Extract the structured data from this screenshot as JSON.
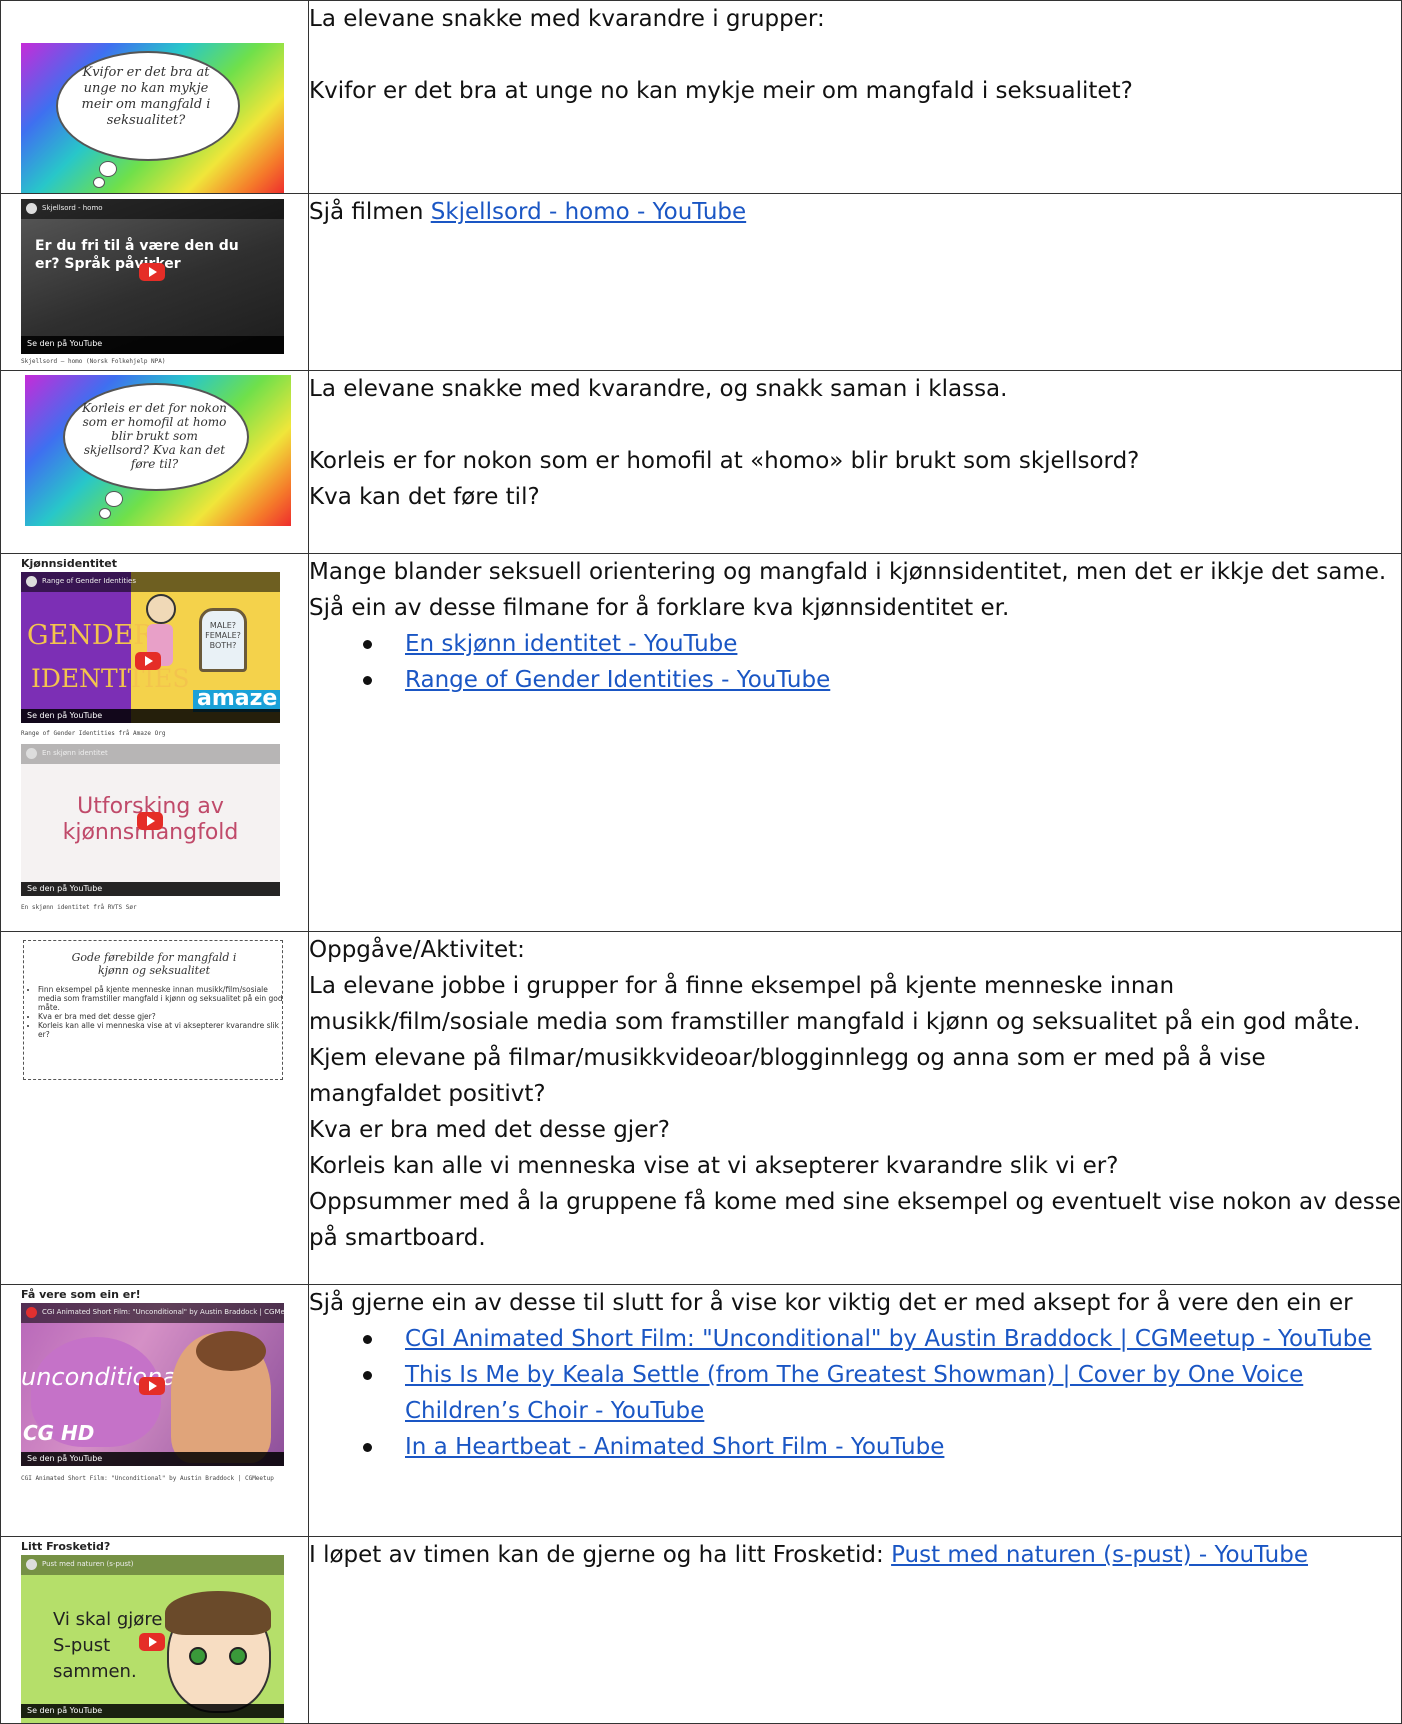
{
  "rows": [
    {
      "thumb": {
        "cloud_text": "Kvifor er det bra at unge no kan mykje meir om mangfald i seksualitet?"
      },
      "paragraphs": [
        "La elevane snakke med kvarandre i grupper:",
        "",
        "Kvifor er det bra at unge no kan mykje meir om mangfald i seksualitet?"
      ]
    },
    {
      "thumb": {
        "video_title": "Skjellsord - homo",
        "overlay_text": "Er du fri til å være den du er? Språk påvirker",
        "bar_text": "Se den på YouTube",
        "caption": "Skjellsord – homo (Norsk Folkehjelp NPA)"
      },
      "text_prefix": "Sjå filmen ",
      "link": "Skjellsord - homo - YouTube"
    },
    {
      "thumb": {
        "cloud_text": "Korleis er det for nokon som er homofil at homo blir brukt som skjellsord? Kva kan det føre til?"
      },
      "paragraphs": [
        "La elevane snakke med kvarandre, og snakk saman i klassa.",
        "",
        "Korleis er for nokon som er homofil at «homo» blir brukt som skjellsord?",
        "Kva kan det føre til?"
      ]
    },
    {
      "thumb": {
        "title": "Kjønnsidentitet",
        "video1_title": "Range of Gender Identities",
        "video1_big1": "GENDER",
        "video1_big2": "IDENTITIES",
        "video1_sign": "MALE? FEMALE? BOTH?",
        "video1_brand": "amaze",
        "caption1": "Range of Gender Identities frå Amaze Org",
        "video2_title": "En skjønn identitet",
        "video2_text": "Utforsking av kjønnsmangfold",
        "caption2": "En skjønn identitet frå RVTS Sør",
        "bar_text": "Se den på YouTube"
      },
      "intro": "Mange blander seksuell orientering og mangfald i kjønnsidentitet, men det er ikkje det same. Sjå ein av desse filmane for å forklare kva kjønnsidentitet er.",
      "links": [
        "En skjønn identitet - YouTube",
        "Range of Gender Identities - YouTube"
      ]
    },
    {
      "thumb": {
        "heading": "Gode førebilde for mangfald i kjønn og seksualitet",
        "bullets": [
          "Finn eksempel på kjente menneske innan musikk/film/sosiale media som framstiller mangfald i kjønn og seksualitet på ein god måte.",
          "Kva er bra med det desse gjer?",
          "Korleis kan alle vi menneska vise at vi aksepterer kvarandre slik vi er?"
        ]
      },
      "paragraphs": [
        "Oppgåve/Aktivitet:",
        "La elevane jobbe i grupper for å finne eksempel på kjente menneske innan musikk/film/sosiale media som framstiller mangfald i kjønn og seksualitet på ein god måte. Kjem elevane på filmar/musikkvideoar/blogginnlegg og anna som er med på å vise mangfaldet positivt?",
        "Kva er bra med det desse gjer?",
        "Korleis kan alle vi menneska vise at vi aksepterer kvarandre slik vi er?",
        "Oppsummer med å la gruppene få kome med sine eksempel og eventuelt vise nokon av desse på smartboard."
      ]
    },
    {
      "thumb": {
        "title": "Få vere som ein er!",
        "video_title": "CGI Animated Short Film: \"Unconditional\" by Austin Braddock | CGMeetup",
        "overlay_text": "unconditional",
        "badge": "CG HD",
        "bar_text": "Se den på YouTube",
        "caption": "CGI Animated Short Film: \"Unconditional\" by Austin Braddock | CGMeetup"
      },
      "intro": "Sjå gjerne ein av desse til slutt for å vise kor viktig det er med aksept for å vere den ein er",
      "links": [
        "CGI Animated Short Film: \"Unconditional\" by Austin Braddock | CGMeetup - YouTube",
        "This Is Me by Keala Settle (from The Greatest Showman) | Cover by One Voice Children’s Choir - YouTube",
        "In a Heartbeat - Animated Short Film - YouTube"
      ]
    },
    {
      "thumb": {
        "title": "Litt Frosketid?",
        "video_title": "Pust med naturen (s-pust)",
        "overlay_text": "Vi skal gjøre S-pust sammen.",
        "bar_text": "Se den på YouTube"
      },
      "text_prefix": "I løpet av timen kan de gjerne og ha litt Frosketid: ",
      "link": "Pust med naturen (s-pust) - YouTube"
    }
  ]
}
